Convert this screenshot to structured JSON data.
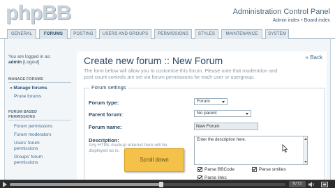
{
  "header": {
    "logo": "phpBB",
    "title": "Administration Control Panel",
    "link_admin_index": "Admin index",
    "separator": "•",
    "link_board_index": "Board index"
  },
  "tabs": [
    {
      "label": "GENERAL",
      "active": false
    },
    {
      "label": "FORUMS",
      "active": true
    },
    {
      "label": "POSTING",
      "active": false
    },
    {
      "label": "USERS AND GROUPS",
      "active": false
    },
    {
      "label": "PERMISSIONS",
      "active": false
    },
    {
      "label": "STYLES",
      "active": false
    },
    {
      "label": "MAINTENANCE",
      "active": false
    },
    {
      "label": "SYSTEM",
      "active": false
    }
  ],
  "sidebar": {
    "logged_in_as": "You are logged in as:",
    "username": "admin",
    "logout_open": "[",
    "logout": "Logout",
    "logout_close": "]",
    "section_manage": "MANAGE FORUMS",
    "item_manage": "Manage forums",
    "item_prune": "Prune forums",
    "section_perm_1": "FORUM BASED",
    "section_perm_2": "PERMISSIONS",
    "item_forum_perm": "Forum permissions",
    "item_forum_mods": "Forum moderators",
    "item_users_perm_1": "Users' forum",
    "item_users_perm_2": "permissions",
    "item_groups_perm_1": "Groups' forum",
    "item_groups_perm_2": "permissions"
  },
  "main": {
    "back": "« Back",
    "title": "Create new forum :: New Forum",
    "intro_1": "The form below will allow you to customise this forum. Please note that moderation and",
    "intro_2": "post count controls are set via forum permissions for each user or usergroup.",
    "legend": "Forum settings",
    "forum_type_label": "Forum type:",
    "forum_type_value": "Forum",
    "parent_label": "Parent forum:",
    "parent_value": "No parent",
    "name_label": "Forum name:",
    "name_value": "New Forum",
    "desc_label": "Description:",
    "desc_help_1": "Any HTML markup entered here will be",
    "desc_help_2": "displayed as is.",
    "desc_value": "Enter the description here.",
    "parse_bbcode": "Parse BBCode",
    "parse_smilies": "Parse smilies",
    "parse_links": "Parse links"
  },
  "overlay": {
    "tooltip": "Scroll down"
  },
  "player": {
    "time": "0/11",
    "progress": 0.55
  }
}
